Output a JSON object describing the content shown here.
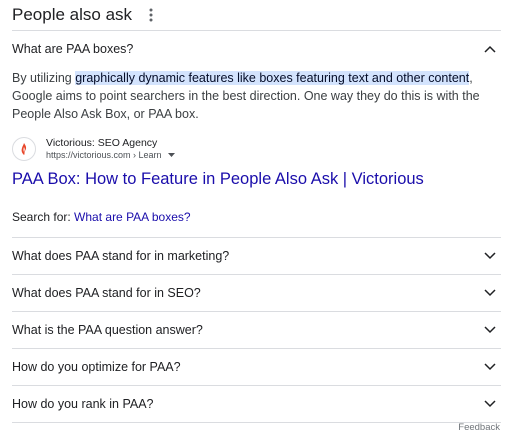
{
  "paa": {
    "title": "People also ask",
    "expanded": {
      "question": "What are PAA boxes?",
      "answer_before": "By utilizing ",
      "answer_highlight": "graphically dynamic features like boxes featuring text and other content",
      "answer_after": ", Google aims to point searchers in the best direction. One way they do this is with the People Also Ask Box, or PAA box.",
      "source": {
        "name": "Victorious: SEO Agency",
        "url": "https://victorious.com › Learn"
      },
      "result_title": "PAA Box: How to Feature in People Also Ask | Victorious",
      "search_for_label": "Search for:",
      "search_for_query": "What are PAA boxes?"
    },
    "questions": [
      "What does PAA stand for in marketing?",
      "What does PAA stand for in SEO?",
      "What is the PAA question answer?",
      "How do you optimize for PAA?",
      "How do you rank in PAA?"
    ],
    "feedback": "Feedback"
  },
  "colors": {
    "link": "#1a0dab",
    "highlight": "#d3e3fd",
    "divider": "#dadce0",
    "favicon_accent": "#e8472b"
  },
  "icons": {
    "more": "more-vert-icon",
    "collapse": "chevron-up-icon",
    "expand": "chevron-down-icon",
    "favicon": "victorious-logo-icon"
  }
}
